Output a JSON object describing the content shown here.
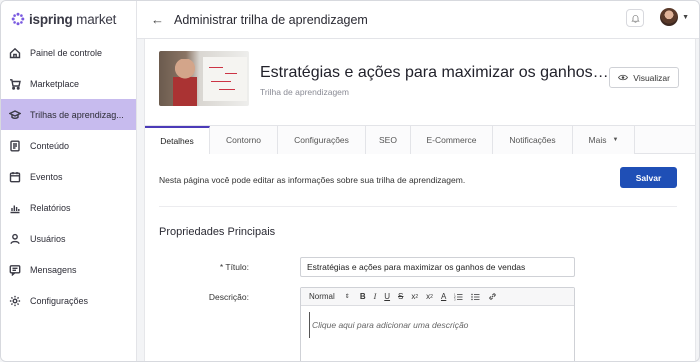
{
  "brand": {
    "name_bold": "ispring",
    "name_rest": "market",
    "accent": "#7a5ae0"
  },
  "sidebar": {
    "items": [
      {
        "label": "Painel de controle",
        "icon": "home-icon",
        "active": false
      },
      {
        "label": "Marketplace",
        "icon": "cart-icon",
        "active": false
      },
      {
        "label": "Trilhas de aprendizag...",
        "icon": "graduation-cap-icon",
        "active": true
      },
      {
        "label": "Conteúdo",
        "icon": "document-icon",
        "active": false
      },
      {
        "label": "Eventos",
        "icon": "calendar-icon",
        "active": false
      },
      {
        "label": "Relatórios",
        "icon": "bar-chart-icon",
        "active": false
      },
      {
        "label": "Usuários",
        "icon": "user-icon",
        "active": false
      },
      {
        "label": "Mensagens",
        "icon": "message-icon",
        "active": false
      },
      {
        "label": "Configurações",
        "icon": "gear-icon",
        "active": false
      }
    ]
  },
  "topbar": {
    "title": "Administrar trilha de aprendizagem"
  },
  "course": {
    "title": "Estratégias e ações para maximizar os ganhos de vendas",
    "subtitle": "Trilha de aprendizagem",
    "view_label": "Visualizar"
  },
  "tabs": [
    {
      "label": "Detalhes",
      "active": true
    },
    {
      "label": "Contorno",
      "active": false
    },
    {
      "label": "Configurações",
      "active": false
    },
    {
      "label": "SEO",
      "active": false
    },
    {
      "label": "E-Commerce",
      "active": false
    },
    {
      "label": "Notificações",
      "active": false
    },
    {
      "label": "Mais",
      "active": false
    }
  ],
  "details": {
    "info": "Nesta página você pode editar as informações sobre sua trilha de aprendizagem.",
    "save_label": "Salvar",
    "section_title": "Propriedades Principais",
    "title_label": "* Título:",
    "title_value": "Estratégias e ações para maximizar os ganhos de vendas",
    "description_label": "Descrição:",
    "editor_format": "Normal",
    "editor_placeholder": "Clique aqui para adicionar uma descrição"
  },
  "colors": {
    "primary": "#1f4fb6",
    "active_nav": "#c7bbee",
    "active_tab_border": "#4b3bb8"
  }
}
